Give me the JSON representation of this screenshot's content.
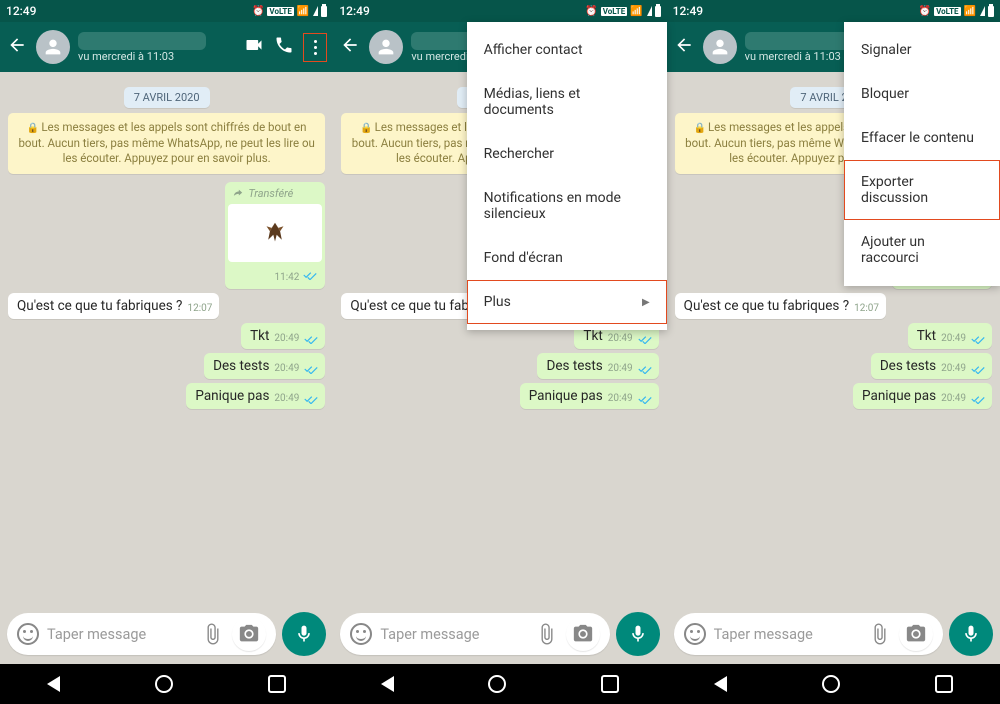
{
  "status": {
    "time": "12:49"
  },
  "header": {
    "contact_name_redacted": "Contact redacted 0",
    "last_seen": "vu mercredi à 11:03"
  },
  "date_badge": "7 AVRIL 2020",
  "encryption_notice": "Les messages et les appels sont chiffrés de bout en bout. Aucun tiers, pas même WhatsApp, ne peut les lire ou les écouter. Appuyez pour en savoir plus.",
  "forwarded_label": "Transféré",
  "messages": {
    "in1": {
      "text": "Qu'est ce que tu fabriques ?",
      "time": "12:07"
    },
    "out_img": {
      "time": "11:42"
    },
    "out1": {
      "text": "Tkt",
      "time": "20:49"
    },
    "out2": {
      "text": "Des tests",
      "time": "20:49"
    },
    "out3": {
      "text": "Panique pas",
      "time": "20:49"
    }
  },
  "input": {
    "placeholder": "Taper message"
  },
  "menu1": {
    "items": [
      "Afficher contact",
      "Médias, liens et documents",
      "Rechercher",
      "Notifications en mode silencieux",
      "Fond d'écran",
      "Plus"
    ]
  },
  "menu2": {
    "items": [
      "Signaler",
      "Bloquer",
      "Effacer le contenu",
      "Exporter discussion",
      "Ajouter un raccourci"
    ]
  }
}
